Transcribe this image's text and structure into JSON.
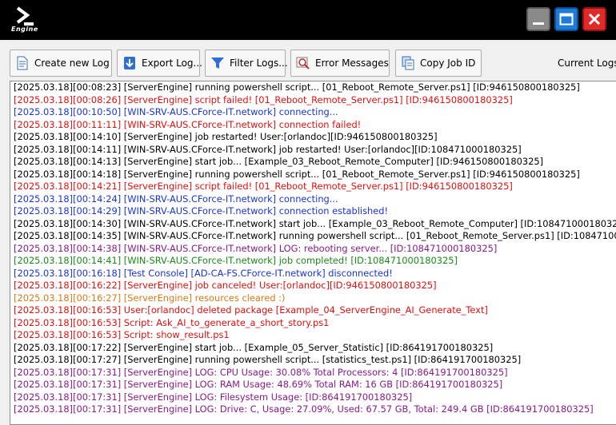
{
  "app": {
    "logo_text": "Engine"
  },
  "toolbar": {
    "create_new_log": "Create new Log",
    "export_log": "Export Log...",
    "filter_logs": "Filter Logs...",
    "error_messages": "Error Messages",
    "copy_job_id": "Copy Job ID",
    "current_logs": "Current Logs"
  },
  "colors": {
    "black": "#000000",
    "red": "#e01010",
    "blue": "#1a35d6",
    "green": "#1a8a1a",
    "orange": "#d97a16",
    "purple": "#8a1a8a"
  },
  "log_lines": [
    {
      "text": "[2025.03.18][00:08:23] [ServerEngine] running powershell script... [01_Reboot_Remote_Server.ps1] [ID:946150800180325]",
      "color": "#000000"
    },
    {
      "text": "[2025.03.18][00:08:26] [ServerEngine] script failed! [01_Reboot_Remote_Server.ps1] [ID:946150800180325]",
      "color": "#e01010"
    },
    {
      "text": "[2025.03.18][00:10:50] [WIN-SRV-AUS.CForce-IT.network] connecting...",
      "color": "#1a35d6"
    },
    {
      "text": "[2025.03.18][00:11:11] [WIN-SRV-AUS.CForce-IT.network] connection failed!",
      "color": "#e01010"
    },
    {
      "text": "[2025.03.18][00:14:10] [ServerEngine] job restarted! User:[orlandoc][ID:946150800180325]",
      "color": "#000000"
    },
    {
      "text": "[2025.03.18][00:14:11] [WIN-SRV-AUS.CForce-IT.network] job restarted! User:[orlandoc][ID:108471000180325]",
      "color": "#000000"
    },
    {
      "text": "[2025.03.18][00:14:13] [ServerEngine] start job... [Example_03_Reboot_Remote_Computer] [ID:946150800180325]",
      "color": "#000000"
    },
    {
      "text": "[2025.03.18][00:14:18] [ServerEngine] running powershell script... [01_Reboot_Remote_Server.ps1] [ID:946150800180325]",
      "color": "#000000"
    },
    {
      "text": "[2025.03.18][00:14:21] [ServerEngine] script failed! [01_Reboot_Remote_Server.ps1] [ID:946150800180325]",
      "color": "#e01010"
    },
    {
      "text": "[2025.03.18][00:14:24] [WIN-SRV-AUS.CForce-IT.network] connecting...",
      "color": "#1a35d6"
    },
    {
      "text": "[2025.03.18][00:14:29] [WIN-SRV-AUS.CForce-IT.network] connection established!",
      "color": "#1a35d6"
    },
    {
      "text": "[2025.03.18][00:14:30] [WIN-SRV-AUS.CForce-IT.network] start job... [Example_03_Reboot_Remote_Computer] [ID:108471000180325]",
      "color": "#000000"
    },
    {
      "text": "[2025.03.18][00:14:35] [WIN-SRV-AUS.CForce-IT.network] running powershell script... [01_Reboot_Remote_Server.ps1] [ID:108471000180325]",
      "color": "#000000"
    },
    {
      "text": "[2025.03.18][00:14:38] [WIN-SRV-AUS.CForce-IT.network] LOG: rebooting server... [ID:108471000180325]",
      "color": "#8a1a8a"
    },
    {
      "text": "[2025.03.18][00:14:41] [WIN-SRV-AUS.CForce-IT.network] job completed! [ID:108471000180325]",
      "color": "#1a8a1a"
    },
    {
      "text": "[2025.03.18][00:16:18] [Test Console] [AD-CA-FS.CForce-IT.network] disconnected!",
      "color": "#1a35d6"
    },
    {
      "text": "[2025.03.18][00:16:22] [ServerEngine] job canceled! User:[orlandoc][ID:946150800180325]",
      "color": "#e01010"
    },
    {
      "text": "[2025.03.18][00:16:27] [ServerEngine] resources cleared :)",
      "color": "#d97a16"
    },
    {
      "text": "[2025.03.18][00:16:53] User:[orlandoc] deleted package [Example_04_ServerEngine_AI_Generate_Text]",
      "color": "#e01010"
    },
    {
      "text": "[2025.03.18][00:16:53] Script: Ask_AI_to_generate_a_short_story.ps1",
      "color": "#e01010"
    },
    {
      "text": "[2025.03.18][00:16:53] Script: show_result.ps1",
      "color": "#e01010"
    },
    {
      "text": "[2025.03.18][00:17:22] [ServerEngine] start job... [Example_05_Server_Statistic] [ID:864191700180325]",
      "color": "#000000"
    },
    {
      "text": "[2025.03.18][00:17:27] [ServerEngine] running powershell script... [statistics_test.ps1] [ID:864191700180325]",
      "color": "#000000"
    },
    {
      "text": "[2025.03.18][00:17:31] [ServerEngine] LOG: CPU Usage: 30.08% Total Processors: 4 [ID:864191700180325]",
      "color": "#8a1a8a"
    },
    {
      "text": "[2025.03.18][00:17:31] [ServerEngine] LOG: RAM Usage: 48.69% Total RAM: 16 GB [ID:864191700180325]",
      "color": "#8a1a8a"
    },
    {
      "text": "[2025.03.18][00:17:31] [ServerEngine] LOG: Filesystem Usage: [ID:864191700180325]",
      "color": "#8a1a8a"
    },
    {
      "text": "[2025.03.18][00:17:31] [ServerEngine] LOG: Drive: C, Usage: 27.09%, Used: 67.57 GB, Total: 249.4 GB [ID:864191700180325]",
      "color": "#8a1a8a"
    }
  ]
}
